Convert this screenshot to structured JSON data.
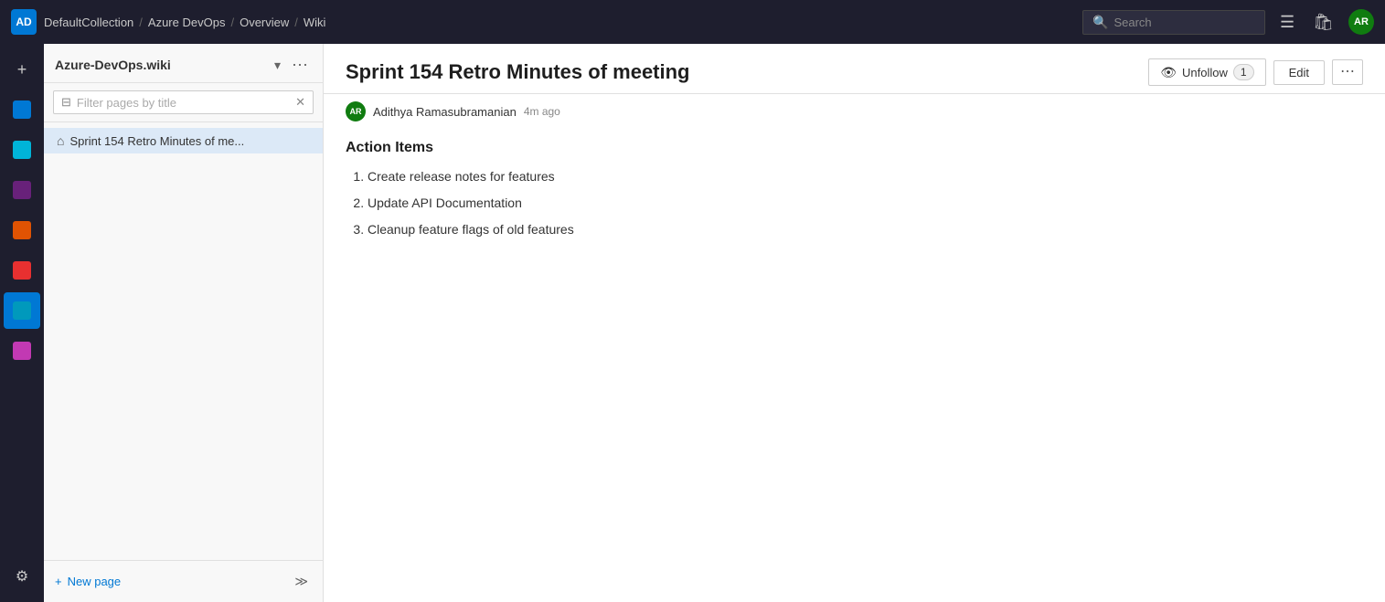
{
  "topbar": {
    "logo_text": "AD",
    "breadcrumb": [
      {
        "label": "DefaultCollection"
      },
      {
        "label": "Azure DevOps"
      },
      {
        "label": "Overview"
      },
      {
        "label": "Wiki"
      }
    ],
    "search_placeholder": "Search",
    "avatar_text": "AR"
  },
  "sidebar": {
    "icons": [
      {
        "id": "overview",
        "symbol": "⊞",
        "active": false
      },
      {
        "id": "boards",
        "symbol": "⬛",
        "active": false,
        "color": "icon-boards"
      },
      {
        "id": "repos",
        "symbol": "⬛",
        "active": false,
        "color": "icon-repos"
      },
      {
        "id": "pipelines",
        "symbol": "⬛",
        "active": false,
        "color": "icon-pipelines"
      },
      {
        "id": "test",
        "symbol": "⬛",
        "active": false,
        "color": "icon-test"
      },
      {
        "id": "artifacts",
        "symbol": "⬛",
        "active": false,
        "color": "icon-artifacts"
      },
      {
        "id": "wiki",
        "symbol": "⬛",
        "active": true,
        "color": "icon-wiki"
      },
      {
        "id": "extra",
        "symbol": "⬛",
        "active": false,
        "color": "icon-extra"
      }
    ],
    "settings_label": "⚙",
    "collapse_label": "≪"
  },
  "wiki_panel": {
    "title": "Azure-DevOps.wiki",
    "dropdown_icon": "▾",
    "more_icon": "⋯",
    "filter_placeholder": "Filter pages by title",
    "tree_item": "Sprint 154 Retro Minutes of me...",
    "new_page_label": "New page",
    "collapse_icon": "≫"
  },
  "content": {
    "page_title": "Sprint 154 Retro Minutes of meeting",
    "unfollow_label": "Unfollow",
    "unfollow_count": "1",
    "edit_label": "Edit",
    "author_avatar": "AR",
    "author_name": "Adithya Ramasubramanian",
    "author_time": "4m ago",
    "section_heading": "Action Items",
    "action_items": [
      "Create release notes for features",
      "Update API Documentation",
      "Cleanup feature flags of old features"
    ]
  }
}
